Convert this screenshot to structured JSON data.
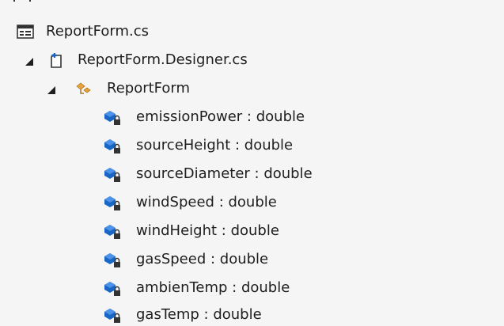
{
  "solution_explorer": {
    "clipped_row_text": "",
    "file_node": {
      "label": "ReportForm.cs",
      "icon": "form-file-icon"
    },
    "designer_node": {
      "label": "ReportForm.Designer.cs",
      "icon": "designer-file-icon",
      "expanded": true
    },
    "class_node": {
      "label": "ReportForm",
      "icon": "class-icon",
      "expanded": true
    },
    "members": [
      {
        "label": "emissionPower : double",
        "icon": "private-field-icon"
      },
      {
        "label": "sourceHeight : double",
        "icon": "private-field-icon"
      },
      {
        "label": "sourceDiameter : double",
        "icon": "private-field-icon"
      },
      {
        "label": "windSpeed : double",
        "icon": "private-field-icon"
      },
      {
        "label": "windHeight : double",
        "icon": "private-field-icon"
      },
      {
        "label": "gasSpeed : double",
        "icon": "private-field-icon"
      },
      {
        "label": "ambienTemp : double",
        "icon": "private-field-icon"
      },
      {
        "label": "gasTemp : double",
        "icon": "private-field-icon"
      }
    ]
  },
  "colors": {
    "background": "#f5f5f5",
    "text": "#1e1e1e",
    "field_blue": "#1a66c5",
    "class_orange": "#e8a33d",
    "lock_dark": "#333333"
  }
}
